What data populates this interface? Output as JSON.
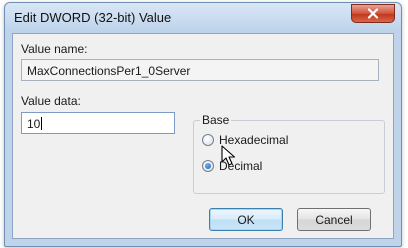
{
  "window": {
    "title": "Edit DWORD (32-bit) Value",
    "close_symbol": "×"
  },
  "value_name": {
    "label": "Value name:",
    "value": "MaxConnectionsPer1_0Server"
  },
  "value_data": {
    "label": "Value data:",
    "value": "10"
  },
  "base": {
    "title": "Base",
    "options": [
      {
        "label": "Hexadecimal",
        "checked": false
      },
      {
        "label": "Decimal",
        "checked": true
      }
    ]
  },
  "buttons": {
    "ok": "OK",
    "cancel": "Cancel"
  },
  "colors": {
    "title_bar": "#bcd2ea",
    "close_button": "#c2381c",
    "client_background": "#f0f0f0",
    "default_button_border": "#3c7fb1"
  },
  "icons": {
    "close": "close-icon",
    "cursor": "mouse-pointer-icon"
  }
}
